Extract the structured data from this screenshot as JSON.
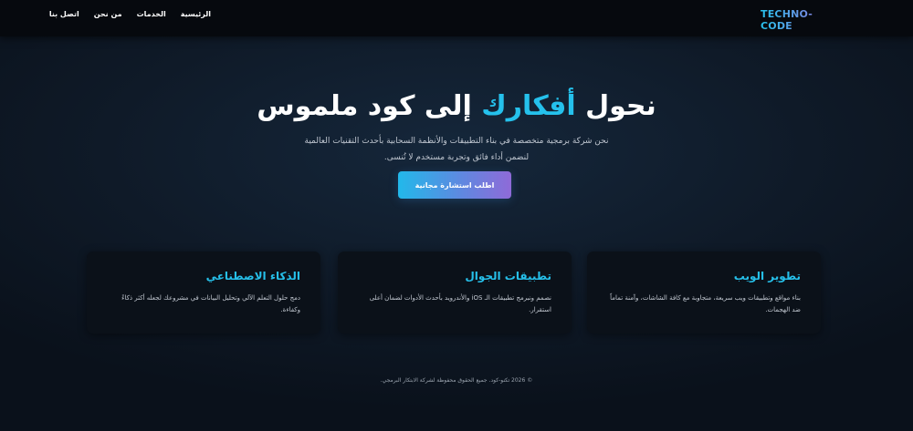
{
  "header": {
    "logo": "TECHNO-CODE",
    "nav": [
      "الرئيسية",
      "الخدمات",
      "من نحن",
      "اتصل بنا"
    ]
  },
  "hero": {
    "title_part1": "نحول ",
    "title_accent": "أفكارك",
    "title_part2": " إلى كود ملموس",
    "description": "نحن شركة برمجية متخصصة في بناء التطبيقات والأنظمة السحابية بأحدث التقنيات العالمية لنضمن أداء فائق وتجربة مستخدم لا تُنسى.",
    "cta_label": "اطلب استشارة مجانية"
  },
  "services": [
    {
      "title": "تطوير الويب",
      "text": "بناء مواقع وتطبيقات ويب سريعة، متجاوبة مع كافة الشاشات، وآمنة تماماً ضد الهجمات."
    },
    {
      "title": "تطبيقات الجوال",
      "text": "نصمم ونبرمج تطبيقات الـ iOS والأندرويد بأحدث الأدوات لضمان أعلى استقرار."
    },
    {
      "title": "الذكاء الاصطناعي",
      "text": "دمج حلول التعلم الآلي وتحليل البيانات في مشروعك لجعله أكثر ذكاءً وكفاءة."
    }
  ],
  "footer": {
    "copyright": "© 2026 تكنو-كود. جميع الحقوق محفوظة لشركة الابتكار البرمجي."
  },
  "colors": {
    "accent": "#25c1ec",
    "gradient_start": "#22b8ea",
    "gradient_end": "#8f6ad8",
    "background": "#0d1520",
    "card_background": "#0b1119"
  }
}
